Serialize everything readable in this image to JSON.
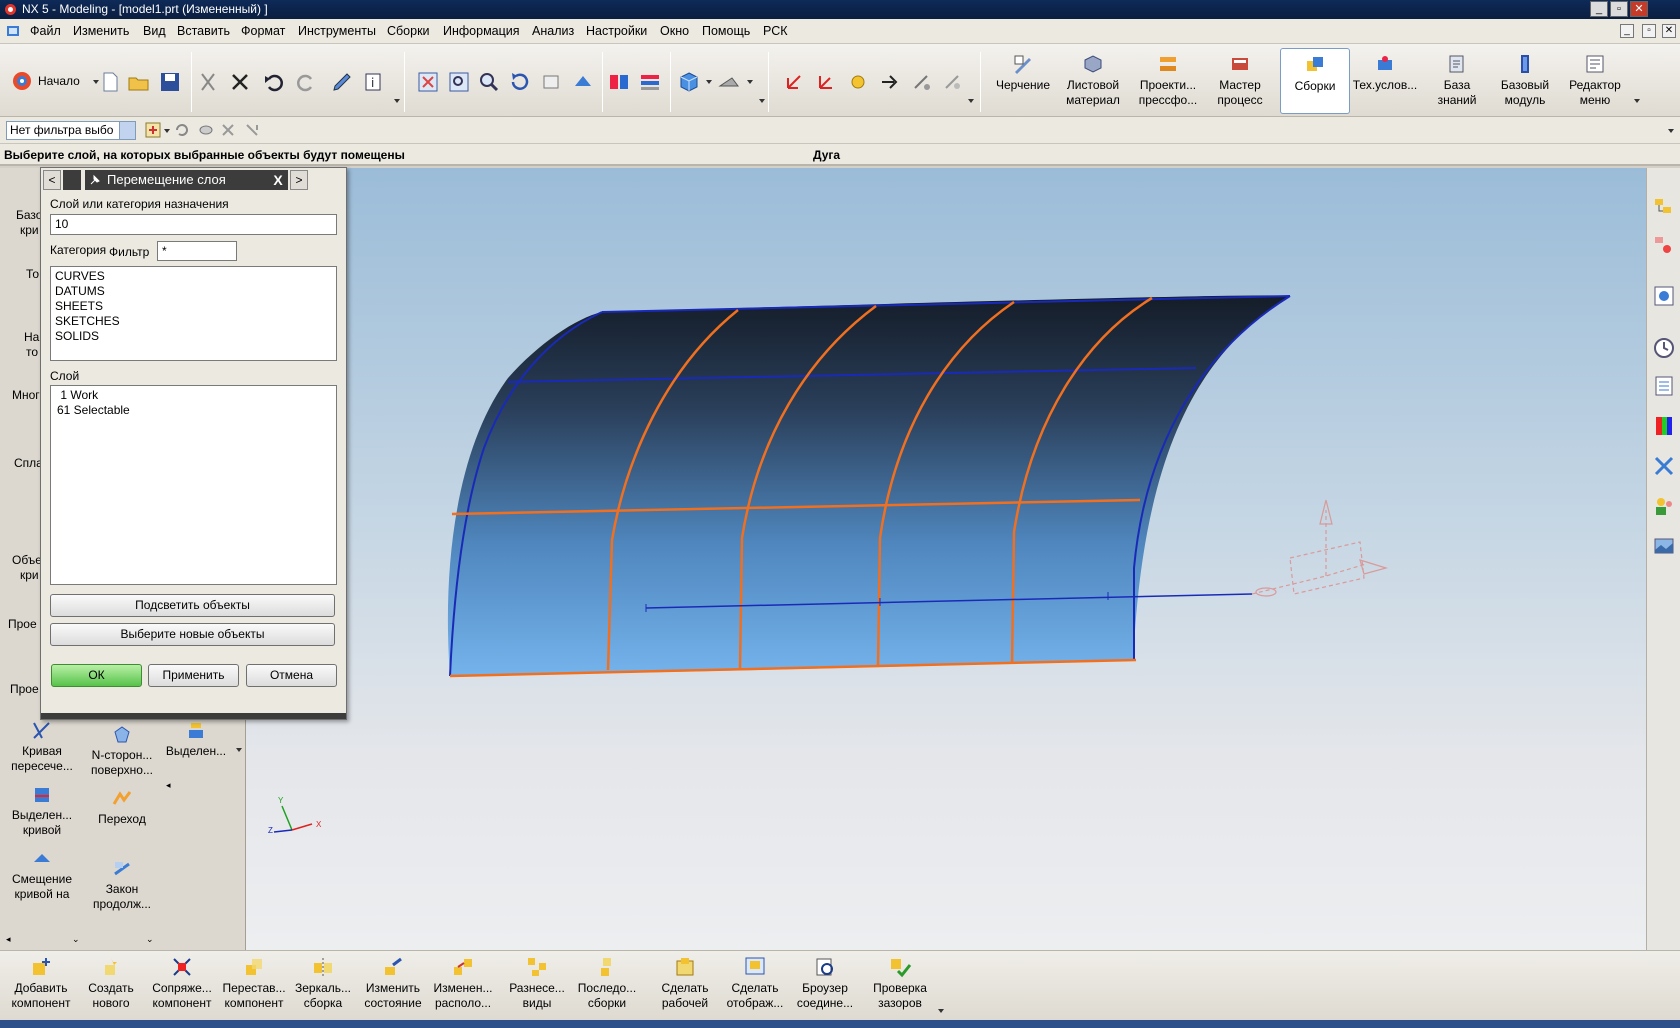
{
  "window": {
    "title": "NX 5 - Modeling - [model1.prt (Измененный) ]",
    "controls": [
      "_",
      "▫",
      "✕"
    ]
  },
  "menu": {
    "items": [
      "Файл",
      "Изменить",
      "Вид",
      "Вставить",
      "Формат",
      "Инструменты",
      "Сборки",
      "Информация",
      "Анализ",
      "Настройки",
      "Окно",
      "Помощь",
      "РСК"
    ],
    "mdi_controls": [
      "_",
      "▫",
      "✕"
    ]
  },
  "toolbar": {
    "start_label": "Начало",
    "apps": [
      {
        "label1": "Черчение",
        "label2": ""
      },
      {
        "label1": "Листовой",
        "label2": "материал"
      },
      {
        "label1": "Проекти...",
        "label2": "прессфо..."
      },
      {
        "label1": "Мастер",
        "label2": "процесс"
      },
      {
        "label1": "Сборки",
        "label2": ""
      },
      {
        "label1": "Тех.услов...",
        "label2": ""
      },
      {
        "label1": "База",
        "label2": "знаний"
      },
      {
        "label1": "Базовый",
        "label2": "модуль"
      },
      {
        "label1": "Редактор",
        "label2": "меню"
      }
    ]
  },
  "filter": {
    "value": "Нет фильтра выбо"
  },
  "status": {
    "cue": "Выберите слой, на которых выбранные объекты будут помещены",
    "selection": "Дуга"
  },
  "dialog": {
    "title": "Перемещение слоя",
    "close": "X",
    "nav_prev": "<",
    "nav_next": ">",
    "dest_label": "Слой или категория назначения",
    "dest_value": "10",
    "category_label": "Категория",
    "filter_label": "Фильтр",
    "filter_value": "*",
    "categories": [
      "CURVES",
      "DATUMS",
      "SHEETS",
      "SKETCHES",
      "SOLIDS"
    ],
    "layer_label": "Слой",
    "layers": [
      " 1 Work",
      "61 Selectable"
    ],
    "highlight_button": "Подсветить объекты",
    "reselect_button": "Выберите новые объекты",
    "ok": "ОК",
    "apply": "Применить",
    "cancel": "Отмена"
  },
  "palette": {
    "partial_labels": [
      "Базо",
      "кри",
      "То",
      "На",
      "то",
      "Мног",
      "Спла",
      "Объе",
      "кри",
      "Прое",
      "Прое"
    ],
    "items": [
      {
        "line1": "Кривая",
        "line2": "пересече..."
      },
      {
        "line1": "N-сторон...",
        "line2": "поверхно..."
      },
      {
        "line1": "Выделен...",
        "line2": ""
      },
      {
        "line1": "Выделен...",
        "line2": "кривой"
      },
      {
        "line1": "Переход",
        "line2": ""
      },
      {
        "line1": "Смещение",
        "line2": "кривой на"
      },
      {
        "line1": "Закон",
        "line2": "продолж..."
      }
    ]
  },
  "bottom_toolbar": {
    "buttons": [
      {
        "line1": "Добавить",
        "line2": "компонент"
      },
      {
        "line1": "Создать",
        "line2": "нового"
      },
      {
        "line1": "Сопряже...",
        "line2": "компонент"
      },
      {
        "line1": "Перестав...",
        "line2": "компонент"
      },
      {
        "line1": "Зеркаль...",
        "line2": "сборка"
      },
      {
        "line1": "Изменить",
        "line2": "состояние"
      },
      {
        "line1": "Изменен...",
        "line2": "располо..."
      },
      {
        "line1": "Разнесе...",
        "line2": "виды"
      },
      {
        "line1": "Последо...",
        "line2": "сборки"
      },
      {
        "line1": "Сделать",
        "line2": "рабочей"
      },
      {
        "line1": "Сделать",
        "line2": "отображ..."
      },
      {
        "line1": "Броузер",
        "line2": "соедине..."
      },
      {
        "line1": "Проверка",
        "line2": "зазоров"
      }
    ]
  },
  "triad": {
    "x": "X",
    "y": "Y",
    "z": "Z"
  },
  "colors": {
    "surface_top": "#1b2636",
    "surface_bottom": "#6aaee8",
    "edge_blue": "#1a2ab8",
    "isoline_orange": "#f07020",
    "dialog_title": "#3c3c3c",
    "ok_green": "#57c24a"
  }
}
